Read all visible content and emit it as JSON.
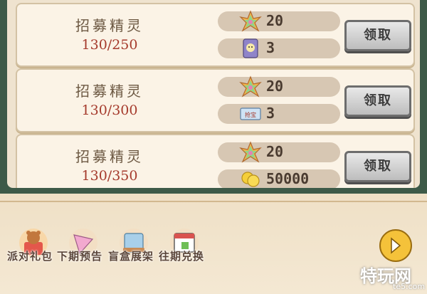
{
  "rewards": [
    {
      "title": "招募精灵",
      "progress": "130/250",
      "items": [
        {
          "icon": "rainbow-leaf-icon",
          "qty": "20"
        },
        {
          "icon": "blind-box-icon",
          "qty": "3"
        }
      ],
      "claim_label": "领取"
    },
    {
      "title": "招募精灵",
      "progress": "130/300",
      "items": [
        {
          "icon": "rainbow-leaf-icon",
          "qty": "20"
        },
        {
          "icon": "ticket-icon",
          "qty": "3",
          "icon_text": "抢宝"
        }
      ],
      "claim_label": "领取"
    },
    {
      "title": "招募精灵",
      "progress": "130/350",
      "items": [
        {
          "icon": "rainbow-leaf-icon",
          "qty": "20"
        },
        {
          "icon": "gold-coin-icon",
          "qty": "50000"
        }
      ],
      "claim_label": "领取"
    }
  ],
  "menu": [
    {
      "label": "派对礼包",
      "icon": "gift-bear-icon"
    },
    {
      "label": "下期预告",
      "icon": "cone-horn-icon"
    },
    {
      "label": "盲盒展架",
      "icon": "display-shelf-icon"
    },
    {
      "label": "往期兑换",
      "icon": "calendar-exchange-icon"
    }
  ],
  "watermark": {
    "brand": "特玩网",
    "url": "te5.com"
  },
  "colors": {
    "progress": "#a53a2c",
    "title": "#6c5842",
    "frame": "#3d5a48"
  }
}
